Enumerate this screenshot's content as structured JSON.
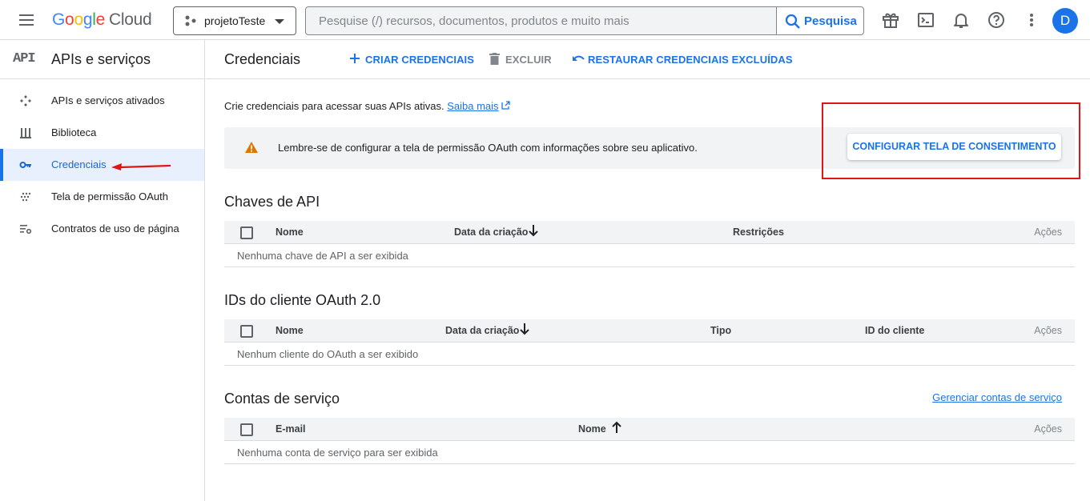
{
  "topbar": {
    "menu_icon": "hamburger-menu-icon",
    "logo": {
      "google": "Google",
      "cloud": "Cloud"
    },
    "project_name": "projetoTeste",
    "search_placeholder": "Pesquise (/) recursos, documentos, produtos e muito mais",
    "search_button": "Pesquisa",
    "avatar_letter": "D",
    "icons": [
      "gift-icon",
      "cloud-shell-icon",
      "bell-icon",
      "help-icon",
      "more-vert-icon"
    ]
  },
  "sidebar": {
    "logo": "API",
    "title": "APIs e serviços",
    "items": [
      {
        "label": "APIs e serviços ativados",
        "icon": "apis-icon"
      },
      {
        "label": "Biblioteca",
        "icon": "library-icon"
      },
      {
        "label": "Credenciais",
        "icon": "key-icon",
        "active": true
      },
      {
        "label": "Tela de permissão OAuth",
        "icon": "oauth-icon"
      },
      {
        "label": "Contratos de uso de página",
        "icon": "settings-list-icon"
      }
    ]
  },
  "main": {
    "title": "Credenciais",
    "actions": {
      "create": "CRIAR CREDENCIAIS",
      "delete": "EXCLUIR",
      "restore": "RESTAURAR CREDENCIAIS EXCLUÍDAS"
    },
    "intro_text": "Crie credenciais para acessar suas APIs ativas.",
    "intro_link": "Saiba mais",
    "banner": {
      "text": "Lembre-se de configurar a tela de permissão OAuth com informações sobre seu aplicativo.",
      "button": "CONFIGURAR TELA DE CONSENTIMENTO"
    },
    "api_keys": {
      "title": "Chaves de API",
      "headers": [
        "Nome",
        "Data da criação",
        "Restrições",
        "Ações"
      ],
      "empty": "Nenhuma chave de API a ser exibida"
    },
    "oauth": {
      "title": "IDs do cliente OAuth 2.0",
      "headers": [
        "Nome",
        "Data da criação",
        "Tipo",
        "ID do cliente",
        "Ações"
      ],
      "empty": "Nenhum cliente do OAuth a ser exibido"
    },
    "service_accounts": {
      "title": "Contas de serviço",
      "manage_link": "Gerenciar contas de serviço",
      "headers": [
        "E-mail",
        "Nome",
        "Ações"
      ],
      "empty": "Nenhuma conta de serviço para ser exibida"
    }
  },
  "colors": {
    "accent": "#1a73e8",
    "active_bg": "#e8f0fe",
    "highlight_red": "#e01515",
    "warning": "#e37400"
  }
}
